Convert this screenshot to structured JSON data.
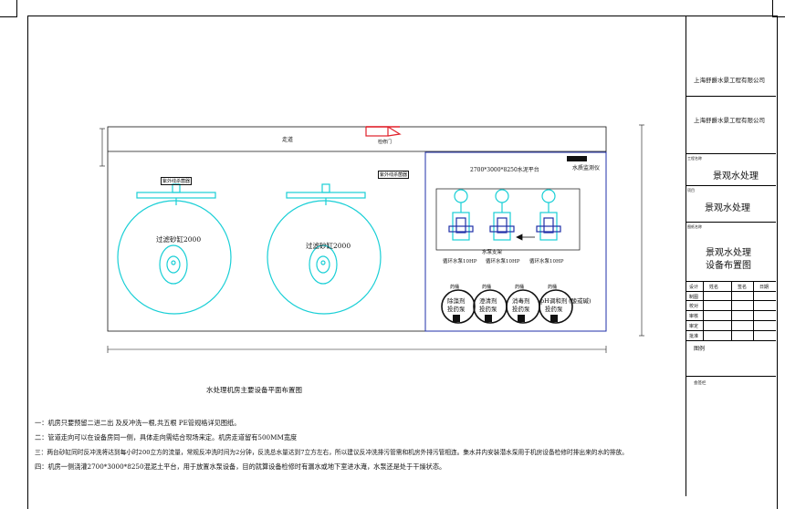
{
  "title_block": {
    "company_1": "上海舒爵水景工程有限公司",
    "company_2": "上海舒爵水景工程有限公司",
    "project_label": "工程名称",
    "project_name": "景观水处理",
    "item_label": "项目",
    "item_name": "景观水处理",
    "drawing_label": "图纸名称",
    "drawing_name_1": "景观水处理",
    "drawing_name_2": "设备布置图",
    "sign_rows": [
      "设计",
      "制图",
      "校对",
      "审核",
      "审定",
      "批准"
    ],
    "sign_headers": [
      "姓名",
      "签名",
      "日期"
    ],
    "legend_label": "图例",
    "stamp_label": "会签栏"
  },
  "plan": {
    "corridor_label": "走道",
    "door_label": "检修门",
    "uv_label_1": "紫外线杀菌器",
    "uv_label_2": "紫外线杀菌器",
    "filter_1_label": "过滤砂缸2000",
    "filter_2_label": "过滤砂缸2000",
    "platform_label": "2700*3000*8250水泥平台",
    "monitor_label": "水质监测仪",
    "pump_group_label": "水泵支架",
    "pump_labels": [
      "循环水泵10HP",
      "循环水泵10HP",
      "循环水泵10HP"
    ],
    "tank_top_labels": [
      "药桶",
      "药桶",
      "药桶",
      "药桶"
    ],
    "tank_labels": [
      [
        "除藻剂",
        "投药泵"
      ],
      [
        "澄清剂",
        "投药泵"
      ],
      [
        "消毒剂",
        "投药泵"
      ],
      [
        "pH调和剂",
        "投药泵"
      ]
    ],
    "acid_alkali_label": "(酸或碱)",
    "drawing_caption": "水处理机房主要设备平面布置图"
  },
  "notes": [
    "一：机房只要预留二进二出 及反冲洗一根,共五根 PE管规格详见图纸。",
    "二：管道走向可以在设备房同一侧，具体走向需结合现场来定。机房走道留有500MM宽度",
    "三：两台砂缸同时反冲洗将达到每小时200立方的流量，常规反冲洗时间为2分钟，反洗总水量达到7立方左右，所以建议反冲洗排污管需和机房外排污管相连。集水井内安装潜水泵用于机房设备检修时排出来的水的排放。",
    "四：机房一侧浇灌2700*3000*8250混泥土平台，用于放置水泵设备，目的就算设备检修时有漏水或地下室进水淹，水泵还是处于干燥状态。"
  ],
  "colors": {
    "equipment": "#19cfd6",
    "platform_border": "#1f2fa8",
    "door": "#e0202a",
    "line": "#111111"
  }
}
